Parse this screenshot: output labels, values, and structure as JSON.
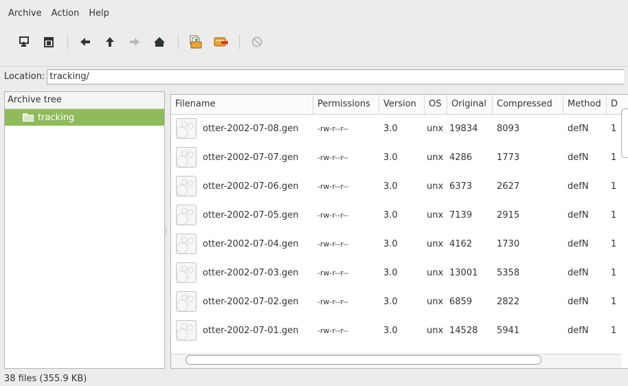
{
  "menu": {
    "items": [
      "Archive",
      "Action",
      "Help"
    ]
  },
  "toolbar": {
    "buttons": [
      "add-files-icon",
      "extract-icon",
      "back-icon",
      "up-icon",
      "forward-icon",
      "home-icon",
      "comment-icon",
      "script-icon",
      "stop-icon"
    ]
  },
  "location": {
    "label": "Location:",
    "value": "tracking/"
  },
  "tree": {
    "header": "Archive tree",
    "nodes": [
      {
        "label": "tracking",
        "selected": true
      }
    ]
  },
  "list": {
    "columns": [
      "Filename",
      "Permissions",
      "Version",
      "OS",
      "Original",
      "Compressed",
      "Method",
      "D"
    ],
    "rows": [
      {
        "filename": "otter-2002-07-08.gen",
        "permissions": "-rw-r--r--",
        "version": "3.0",
        "os": "unx",
        "original": "19834",
        "compressed": "8093",
        "method": "defN",
        "date": "1"
      },
      {
        "filename": "otter-2002-07-07.gen",
        "permissions": "-rw-r--r--",
        "version": "3.0",
        "os": "unx",
        "original": "4286",
        "compressed": "1773",
        "method": "defN",
        "date": "1"
      },
      {
        "filename": "otter-2002-07-06.gen",
        "permissions": "-rw-r--r--",
        "version": "3.0",
        "os": "unx",
        "original": "6373",
        "compressed": "2627",
        "method": "defN",
        "date": "1"
      },
      {
        "filename": "otter-2002-07-05.gen",
        "permissions": "-rw-r--r--",
        "version": "3.0",
        "os": "unx",
        "original": "7139",
        "compressed": "2915",
        "method": "defN",
        "date": "1"
      },
      {
        "filename": "otter-2002-07-04.gen",
        "permissions": "-rw-r--r--",
        "version": "3.0",
        "os": "unx",
        "original": "4162",
        "compressed": "1730",
        "method": "defN",
        "date": "1"
      },
      {
        "filename": "otter-2002-07-03.gen",
        "permissions": "-rw-r--r--",
        "version": "3.0",
        "os": "unx",
        "original": "13001",
        "compressed": "5358",
        "method": "defN",
        "date": "1"
      },
      {
        "filename": "otter-2002-07-02.gen",
        "permissions": "-rw-r--r--",
        "version": "3.0",
        "os": "unx",
        "original": "6859",
        "compressed": "2822",
        "method": "defN",
        "date": "1"
      },
      {
        "filename": "otter-2002-07-01.gen",
        "permissions": "-rw-r--r--",
        "version": "3.0",
        "os": "unx",
        "original": "14528",
        "compressed": "5941",
        "method": "defN",
        "date": "1"
      }
    ]
  },
  "status": {
    "text": "38 files  (355.9 KB)"
  },
  "colors": {
    "selection": "#8fbb5c",
    "window_bg": "#edeceb"
  }
}
